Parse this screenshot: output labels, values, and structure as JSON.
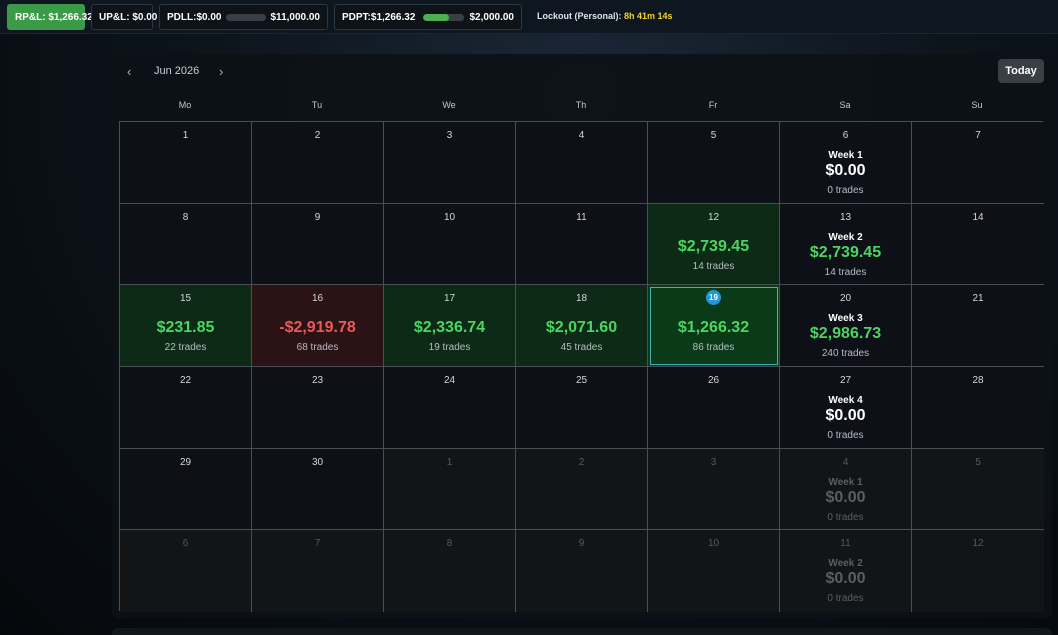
{
  "topbar": {
    "rpl": "RP&L: $1,266.32",
    "upl": "UP&L: $0.00",
    "pdll_label": "PDLL:$0.00",
    "pdll_limit": "$11,000.00",
    "pdll_progress": 0.0,
    "pdpt_label": "PDPT:$1,266.32",
    "pdpt_target": "$2,000.00",
    "pdpt_progress": 0.63,
    "lockout_label": "Lockout (Personal):",
    "lockout_time": "8h 41m 14s"
  },
  "calendar": {
    "month_label": "Jun 2026",
    "today_button": "Today",
    "prev_icon": "chevron-left-icon",
    "next_icon": "chevron-right-icon",
    "weekdays": [
      "Mo",
      "Tu",
      "We",
      "Th",
      "Fr",
      "Sa",
      "Su"
    ],
    "weeks": [
      [
        {
          "day": "1"
        },
        {
          "day": "2"
        },
        {
          "day": "3"
        },
        {
          "day": "4"
        },
        {
          "day": "5"
        },
        {
          "day": "6",
          "week_label": "Week 1",
          "week_total": "$0.00",
          "week_trades": "0 trades"
        },
        {
          "day": "7"
        }
      ],
      [
        {
          "day": "8"
        },
        {
          "day": "9"
        },
        {
          "day": "10"
        },
        {
          "day": "11"
        },
        {
          "day": "12",
          "amount": "$2,739.45",
          "trades": "14 trades",
          "status": "pos"
        },
        {
          "day": "13",
          "week_label": "Week 2",
          "week_total": "$2,739.45",
          "week_trades": "14 trades",
          "week_status": "pos"
        },
        {
          "day": "14"
        }
      ],
      [
        {
          "day": "15",
          "amount": "$231.85",
          "trades": "22 trades",
          "status": "pos"
        },
        {
          "day": "16",
          "amount": "-$2,919.78",
          "trades": "68 trades",
          "status": "neg"
        },
        {
          "day": "17",
          "amount": "$2,336.74",
          "trades": "19 trades",
          "status": "pos"
        },
        {
          "day": "18",
          "amount": "$2,071.60",
          "trades": "45 trades",
          "status": "pos"
        },
        {
          "day": "19",
          "amount": "$1,266.32",
          "trades": "86 trades",
          "status": "pos",
          "today": true
        },
        {
          "day": "20",
          "week_label": "Week 3",
          "week_total": "$2,986.73",
          "week_trades": "240 trades",
          "week_status": "pos"
        },
        {
          "day": "21"
        }
      ],
      [
        {
          "day": "22"
        },
        {
          "day": "23"
        },
        {
          "day": "24"
        },
        {
          "day": "25"
        },
        {
          "day": "26"
        },
        {
          "day": "27",
          "week_label": "Week 4",
          "week_total": "$0.00",
          "week_trades": "0 trades"
        },
        {
          "day": "28"
        }
      ],
      [
        {
          "day": "29"
        },
        {
          "day": "30"
        },
        {
          "day": "1",
          "other": true
        },
        {
          "day": "2",
          "other": true
        },
        {
          "day": "3",
          "other": true
        },
        {
          "day": "4",
          "other": true,
          "week_label": "Week 1",
          "week_total": "$0.00",
          "week_trades": "0 trades"
        },
        {
          "day": "5",
          "other": true
        }
      ],
      [
        {
          "day": "6",
          "other": true
        },
        {
          "day": "7",
          "other": true
        },
        {
          "day": "8",
          "other": true
        },
        {
          "day": "9",
          "other": true
        },
        {
          "day": "10",
          "other": true
        },
        {
          "day": "11",
          "other": true,
          "week_label": "Week 2",
          "week_total": "$0.00",
          "week_trades": "0 trades"
        },
        {
          "day": "12",
          "other": true
        }
      ]
    ]
  },
  "colors": {
    "positive": "#4cd562",
    "negative": "#ea5a5a",
    "today_badge": "#2596d6",
    "lockout_time": "#f2d22e",
    "rpl_pill": "#3b9a48"
  }
}
